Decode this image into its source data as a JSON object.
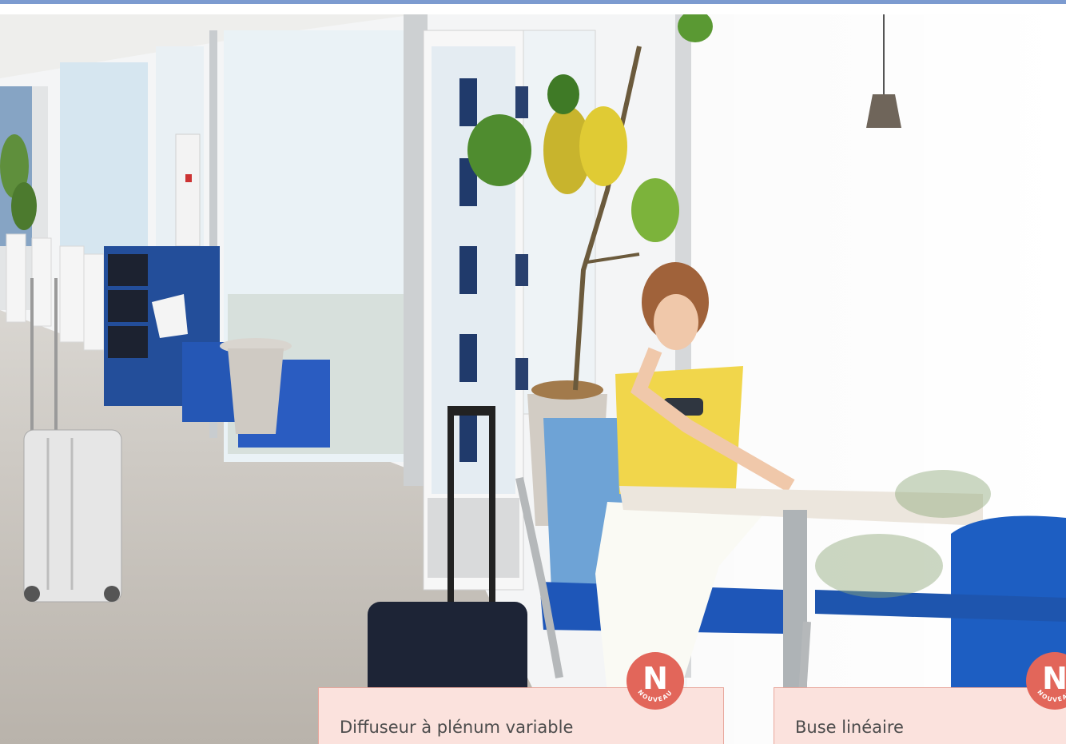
{
  "colors": {
    "top_bar": "#7c9bd0",
    "card_background": "#fbe2dd",
    "card_border": "#e8a79c",
    "badge": "#e2665a",
    "label_text": "#4c4c4c"
  },
  "photo": {
    "icon": "lounge-photo"
  },
  "products": [
    {
      "label": "Diffuseur à plénum variable",
      "badge_letter": "N",
      "badge_word": "NOUVEAU"
    },
    {
      "label": "Buse linéaire",
      "badge_letter": "N",
      "badge_word": "NOUVEAU"
    }
  ]
}
